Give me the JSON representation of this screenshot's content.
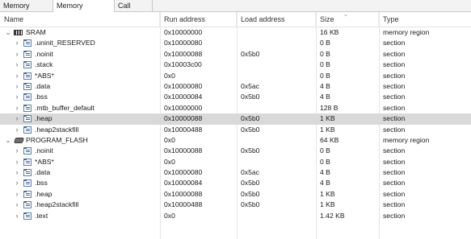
{
  "tabs": [
    {
      "label": "Memory Usage"
    },
    {
      "label": "Memory Contents"
    },
    {
      "label": "Call Graph"
    }
  ],
  "columns": {
    "name": "Name",
    "run": "Run address",
    "load": "Load address",
    "size": "Size",
    "type": "Type"
  },
  "rows": [
    {
      "name": "SRAM",
      "run": "0x10000000",
      "load": "",
      "size": "16 KB",
      "type": "memory region"
    },
    {
      "name": ".uninit_RESERVED",
      "run": "0x10000080",
      "load": "",
      "size": "0 B",
      "type": "section"
    },
    {
      "name": ".noinit",
      "run": "0x10000088",
      "load": "0x5b0",
      "size": "0 B",
      "type": "section"
    },
    {
      "name": ".stack",
      "run": "0x10003c00",
      "load": "",
      "size": "0 B",
      "type": "section"
    },
    {
      "name": "*ABS*",
      "run": "0x0",
      "load": "",
      "size": "0 B",
      "type": "section"
    },
    {
      "name": ".data",
      "run": "0x10000080",
      "load": "0x5ac",
      "size": "4 B",
      "type": "section"
    },
    {
      "name": ".bss",
      "run": "0x10000084",
      "load": "0x5b0",
      "size": "4 B",
      "type": "section"
    },
    {
      "name": ".mtb_buffer_default",
      "run": "0x10000000",
      "load": "",
      "size": "128 B",
      "type": "section"
    },
    {
      "name": ".heap",
      "run": "0x10000088",
      "load": "0x5b0",
      "size": "1 KB",
      "type": "section"
    },
    {
      "name": ".heap2stackfill",
      "run": "0x10000488",
      "load": "0x5b0",
      "size": "1 KB",
      "type": "section"
    },
    {
      "name": "PROGRAM_FLASH",
      "run": "0x0",
      "load": "",
      "size": "64 KB",
      "type": "memory region"
    },
    {
      "name": ".noinit",
      "run": "0x10000088",
      "load": "0x5b0",
      "size": "0 B",
      "type": "section"
    },
    {
      "name": "*ABS*",
      "run": "0x0",
      "load": "",
      "size": "0 B",
      "type": "section"
    },
    {
      "name": ".data",
      "run": "0x10000080",
      "load": "0x5ac",
      "size": "4 B",
      "type": "section"
    },
    {
      "name": ".bss",
      "run": "0x10000084",
      "load": "0x5b0",
      "size": "4 B",
      "type": "section"
    },
    {
      "name": ".heap",
      "run": "0x10000088",
      "load": "0x5b0",
      "size": "1 KB",
      "type": "section"
    },
    {
      "name": ".heap2stackfill",
      "run": "0x10000488",
      "load": "0x5b0",
      "size": "1 KB",
      "type": "section"
    },
    {
      "name": ".text",
      "run": "0x0",
      "load": "",
      "size": "1.42 KB",
      "type": "section"
    }
  ],
  "icons": {
    "expanded": "chevron-down-icon",
    "collapsed": "chevron-right-icon",
    "sram": "ram-chip-icon",
    "flash": "flash-chip-icon",
    "section": "section-icon"
  },
  "colors": {
    "selected_row": "#d9d9d9",
    "tab_background": "#f3f3f3"
  }
}
